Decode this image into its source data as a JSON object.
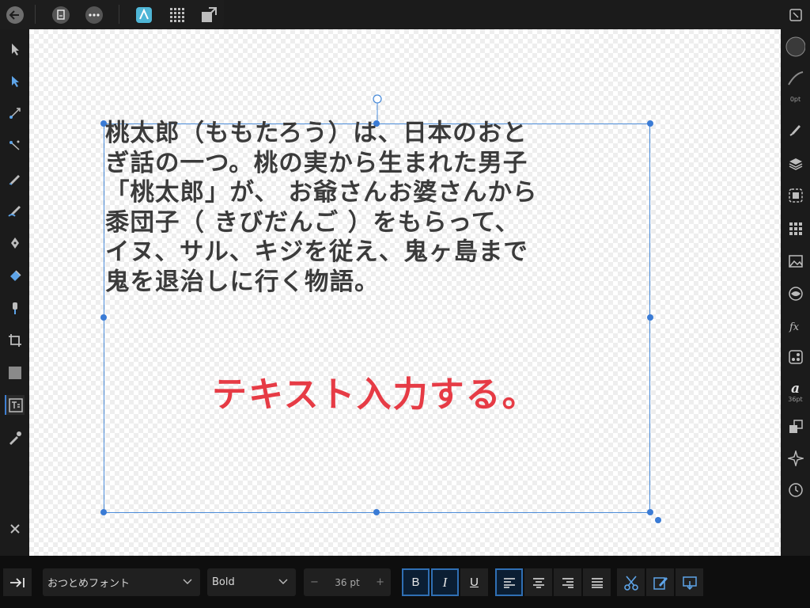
{
  "toolbar_icons": [
    "back-arrow-icon",
    "document-icon",
    "more-icon",
    "designer-persona-icon",
    "pixel-persona-icon",
    "export-persona-icon"
  ],
  "left_tools": [
    "move-tool-icon",
    "node-tool-icon",
    "corner-tool-icon",
    "point-transform-icon",
    "pencil-tool-icon",
    "vector-brush-icon",
    "pen-tool-icon",
    "fill-tool-icon",
    "transparency-tool-icon",
    "crop-tool-icon",
    "shape-tool-icon",
    "frame-text-tool-icon",
    "color-picker-icon",
    "close-icon"
  ],
  "right_studio": {
    "fill_color": "#3a3a3a",
    "stroke_width_label": "0pt",
    "character_size_label": "36pt",
    "character_glyph": "a",
    "fx_glyph": "fx"
  },
  "document": {
    "body_lines": [
      "桃太郎（ももたろう）は、日本のおと",
      "ぎ話の一つ。桃の実から生まれた男子",
      "「桃太郎」が、 お爺さんお婆さんから",
      "黍団子（ きびだんご ）をもらって、",
      "イヌ、サル、キジを従え、鬼ヶ島まで",
      "鬼を退治しに行く物語。"
    ],
    "annotation": "テキスト入力する。",
    "text_color": "#3b3b3b",
    "annotation_color": "#e63b45",
    "selection_color": "#3a7bd5"
  },
  "bottom_bar": {
    "font_name": "おつとめフォント",
    "font_style": "Bold",
    "font_size": "36 pt",
    "minus": "−",
    "plus": "+",
    "bold_label": "B",
    "italic_label": "I",
    "underline_label": "U"
  }
}
